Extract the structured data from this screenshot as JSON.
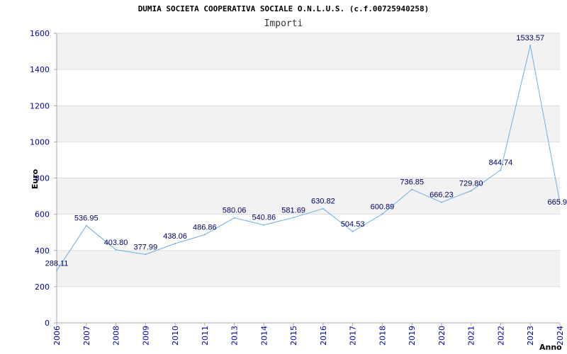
{
  "chart_data": {
    "type": "line",
    "title": "DUMIA SOCIETA COOPERATIVA SOCIALE O.N.L.U.S. (c.f.00725940258)",
    "subtitle": "Importi",
    "xlabel": "Anno",
    "ylabel": "Euro",
    "ylim": [
      0,
      1600
    ],
    "yticks": [
      0,
      200,
      400,
      600,
      800,
      1000,
      1200,
      1400,
      1600
    ],
    "x": [
      "2006",
      "2007",
      "2008",
      "2009",
      "2010",
      "2011",
      "2013",
      "2014",
      "2015",
      "2016",
      "2017",
      "2018",
      "2019",
      "2020",
      "2021",
      "2022",
      "2023",
      "2024"
    ],
    "series": [
      {
        "values": [
          288.11,
          536.95,
          403.8,
          377.99,
          438.06,
          486.86,
          580.06,
          540.86,
          581.69,
          630.82,
          504.53,
          600.89,
          736.85,
          666.23,
          729.8,
          844.74,
          1533.57,
          665.9
        ],
        "labels": [
          "288.11",
          "536.95",
          "403.80",
          "377.99",
          "438.06",
          "486.86",
          "580.06",
          "540.86",
          "581.69",
          "630.82",
          "504.53",
          "600.89",
          "736.85",
          "666.23",
          "729.80",
          "844.74",
          "1533.57",
          "665.9"
        ]
      }
    ],
    "grid": true,
    "legend": "none",
    "colors": {
      "line": "#6aaee8",
      "band": "#f2f2f2",
      "gridline": "#dddddd",
      "axis": "#aaaaaa",
      "tick_text": "#0000aa",
      "data_label": "#000066"
    }
  }
}
